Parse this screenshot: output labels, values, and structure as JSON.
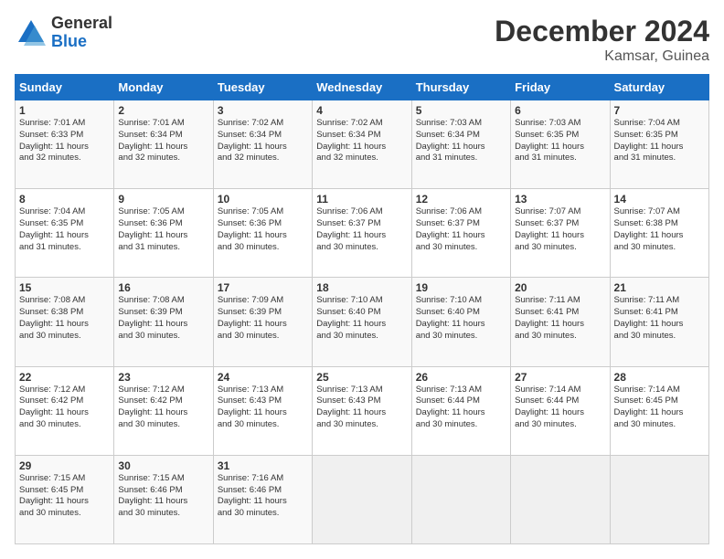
{
  "logo": {
    "general": "General",
    "blue": "Blue"
  },
  "title": "December 2024",
  "subtitle": "Kamsar, Guinea",
  "days_of_week": [
    "Sunday",
    "Monday",
    "Tuesday",
    "Wednesday",
    "Thursday",
    "Friday",
    "Saturday"
  ],
  "weeks": [
    [
      {
        "day": "1",
        "info": "Sunrise: 7:01 AM\nSunset: 6:33 PM\nDaylight: 11 hours\nand 32 minutes."
      },
      {
        "day": "2",
        "info": "Sunrise: 7:01 AM\nSunset: 6:34 PM\nDaylight: 11 hours\nand 32 minutes."
      },
      {
        "day": "3",
        "info": "Sunrise: 7:02 AM\nSunset: 6:34 PM\nDaylight: 11 hours\nand 32 minutes."
      },
      {
        "day": "4",
        "info": "Sunrise: 7:02 AM\nSunset: 6:34 PM\nDaylight: 11 hours\nand 32 minutes."
      },
      {
        "day": "5",
        "info": "Sunrise: 7:03 AM\nSunset: 6:34 PM\nDaylight: 11 hours\nand 31 minutes."
      },
      {
        "day": "6",
        "info": "Sunrise: 7:03 AM\nSunset: 6:35 PM\nDaylight: 11 hours\nand 31 minutes."
      },
      {
        "day": "7",
        "info": "Sunrise: 7:04 AM\nSunset: 6:35 PM\nDaylight: 11 hours\nand 31 minutes."
      }
    ],
    [
      {
        "day": "8",
        "info": "Sunrise: 7:04 AM\nSunset: 6:35 PM\nDaylight: 11 hours\nand 31 minutes."
      },
      {
        "day": "9",
        "info": "Sunrise: 7:05 AM\nSunset: 6:36 PM\nDaylight: 11 hours\nand 31 minutes."
      },
      {
        "day": "10",
        "info": "Sunrise: 7:05 AM\nSunset: 6:36 PM\nDaylight: 11 hours\nand 30 minutes."
      },
      {
        "day": "11",
        "info": "Sunrise: 7:06 AM\nSunset: 6:37 PM\nDaylight: 11 hours\nand 30 minutes."
      },
      {
        "day": "12",
        "info": "Sunrise: 7:06 AM\nSunset: 6:37 PM\nDaylight: 11 hours\nand 30 minutes."
      },
      {
        "day": "13",
        "info": "Sunrise: 7:07 AM\nSunset: 6:37 PM\nDaylight: 11 hours\nand 30 minutes."
      },
      {
        "day": "14",
        "info": "Sunrise: 7:07 AM\nSunset: 6:38 PM\nDaylight: 11 hours\nand 30 minutes."
      }
    ],
    [
      {
        "day": "15",
        "info": "Sunrise: 7:08 AM\nSunset: 6:38 PM\nDaylight: 11 hours\nand 30 minutes."
      },
      {
        "day": "16",
        "info": "Sunrise: 7:08 AM\nSunset: 6:39 PM\nDaylight: 11 hours\nand 30 minutes."
      },
      {
        "day": "17",
        "info": "Sunrise: 7:09 AM\nSunset: 6:39 PM\nDaylight: 11 hours\nand 30 minutes."
      },
      {
        "day": "18",
        "info": "Sunrise: 7:10 AM\nSunset: 6:40 PM\nDaylight: 11 hours\nand 30 minutes."
      },
      {
        "day": "19",
        "info": "Sunrise: 7:10 AM\nSunset: 6:40 PM\nDaylight: 11 hours\nand 30 minutes."
      },
      {
        "day": "20",
        "info": "Sunrise: 7:11 AM\nSunset: 6:41 PM\nDaylight: 11 hours\nand 30 minutes."
      },
      {
        "day": "21",
        "info": "Sunrise: 7:11 AM\nSunset: 6:41 PM\nDaylight: 11 hours\nand 30 minutes."
      }
    ],
    [
      {
        "day": "22",
        "info": "Sunrise: 7:12 AM\nSunset: 6:42 PM\nDaylight: 11 hours\nand 30 minutes."
      },
      {
        "day": "23",
        "info": "Sunrise: 7:12 AM\nSunset: 6:42 PM\nDaylight: 11 hours\nand 30 minutes."
      },
      {
        "day": "24",
        "info": "Sunrise: 7:13 AM\nSunset: 6:43 PM\nDaylight: 11 hours\nand 30 minutes."
      },
      {
        "day": "25",
        "info": "Sunrise: 7:13 AM\nSunset: 6:43 PM\nDaylight: 11 hours\nand 30 minutes."
      },
      {
        "day": "26",
        "info": "Sunrise: 7:13 AM\nSunset: 6:44 PM\nDaylight: 11 hours\nand 30 minutes."
      },
      {
        "day": "27",
        "info": "Sunrise: 7:14 AM\nSunset: 6:44 PM\nDaylight: 11 hours\nand 30 minutes."
      },
      {
        "day": "28",
        "info": "Sunrise: 7:14 AM\nSunset: 6:45 PM\nDaylight: 11 hours\nand 30 minutes."
      }
    ],
    [
      {
        "day": "29",
        "info": "Sunrise: 7:15 AM\nSunset: 6:45 PM\nDaylight: 11 hours\nand 30 minutes."
      },
      {
        "day": "30",
        "info": "Sunrise: 7:15 AM\nSunset: 6:46 PM\nDaylight: 11 hours\nand 30 minutes."
      },
      {
        "day": "31",
        "info": "Sunrise: 7:16 AM\nSunset: 6:46 PM\nDaylight: 11 hours\nand 30 minutes."
      },
      {
        "day": "",
        "info": ""
      },
      {
        "day": "",
        "info": ""
      },
      {
        "day": "",
        "info": ""
      },
      {
        "day": "",
        "info": ""
      }
    ]
  ]
}
